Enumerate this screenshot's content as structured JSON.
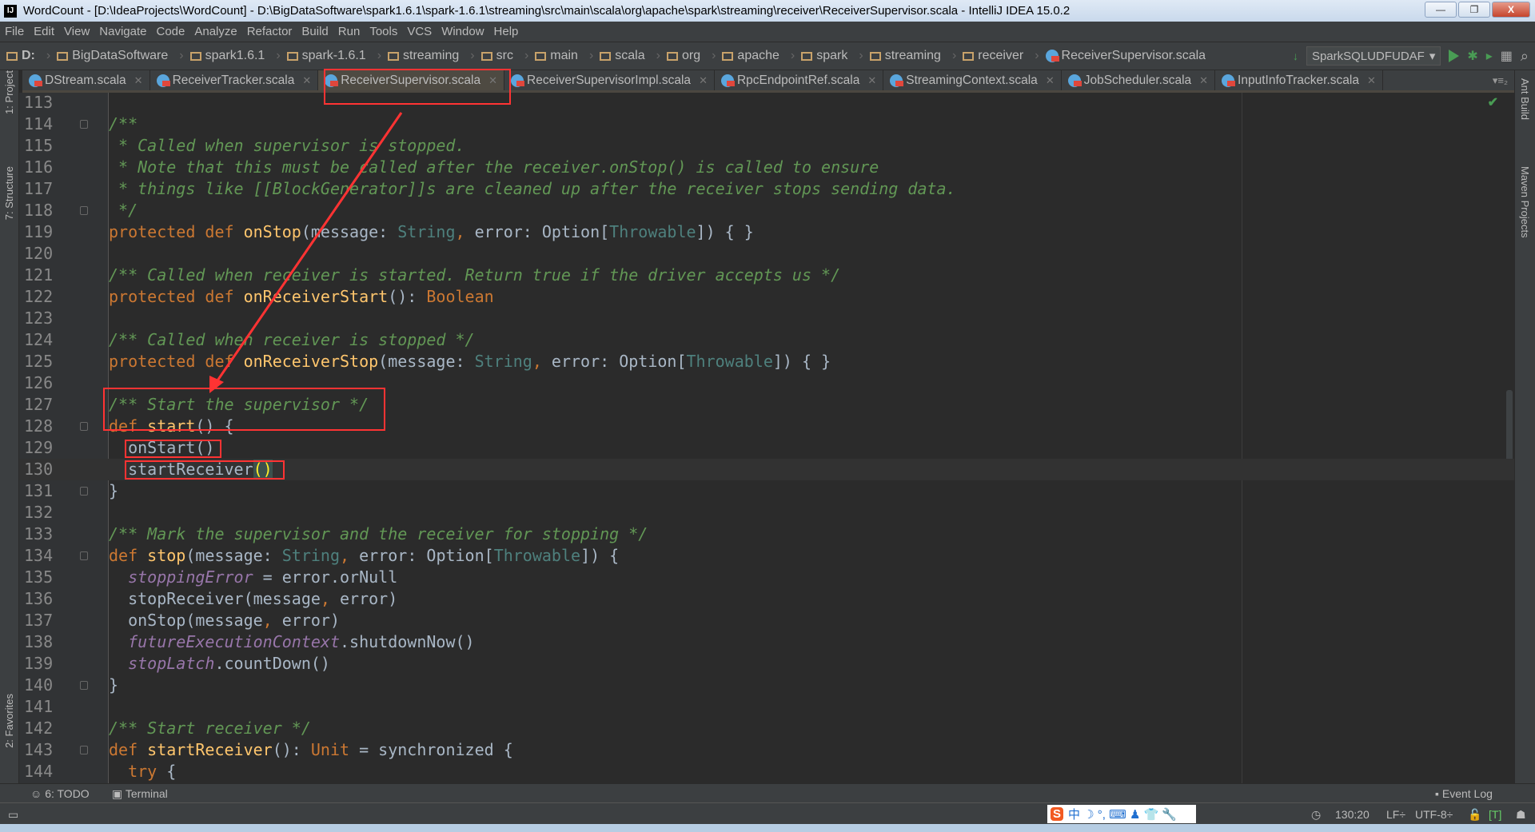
{
  "window": {
    "title": "WordCount - [D:\\IdeaProjects\\WordCount] - D:\\BigDataSoftware\\spark1.6.1\\spark-1.6.1\\streaming\\src\\main\\scala\\org\\apache\\spark\\streaming\\receiver\\ReceiverSupervisor.scala - IntelliJ IDEA 15.0.2",
    "logo": "IJ",
    "minimize": "—",
    "restore": "❐",
    "close": "X"
  },
  "menu": [
    "File",
    "Edit",
    "View",
    "Navigate",
    "Code",
    "Analyze",
    "Refactor",
    "Build",
    "Run",
    "Tools",
    "VCS",
    "Window",
    "Help"
  ],
  "breadcrumbs": [
    "D:",
    "BigDataSoftware",
    "spark1.6.1",
    "spark-1.6.1",
    "streaming",
    "src",
    "main",
    "scala",
    "org",
    "apache",
    "spark",
    "streaming",
    "receiver",
    "ReceiverSupervisor.scala"
  ],
  "run_config": "SparkSQLUDFUDAF",
  "tabs": [
    {
      "label": "DStream.scala"
    },
    {
      "label": "ReceiverTracker.scala"
    },
    {
      "label": "ReceiverSupervisor.scala",
      "active": true
    },
    {
      "label": "ReceiverSupervisorImpl.scala"
    },
    {
      "label": "RpcEndpointRef.scala"
    },
    {
      "label": "StreamingContext.scala"
    },
    {
      "label": "JobScheduler.scala"
    },
    {
      "label": "InputInfoTracker.scala"
    }
  ],
  "tab_menu": "▾≡₂",
  "left_tools": [
    "1: Project",
    "7: Structure",
    "2: Favorites"
  ],
  "right_tools": [
    "Ant Build",
    "Maven Projects"
  ],
  "current_line": 130,
  "code": [
    {
      "n": 113,
      "t": []
    },
    {
      "n": 114,
      "fold": true,
      "t": [
        [
          "/**",
          "c"
        ]
      ]
    },
    {
      "n": 115,
      "t": [
        [
          " * Called when supervisor is stopped.",
          "c"
        ]
      ]
    },
    {
      "n": 116,
      "t": [
        [
          " * Note that this must be called after the receiver.onStop() is called to ensure",
          "c"
        ]
      ]
    },
    {
      "n": 117,
      "t": [
        [
          " * things like [[BlockGenerator]]s are cleaned up after the receiver stops sending data.",
          "c"
        ]
      ]
    },
    {
      "n": 118,
      "fold": true,
      "t": [
        [
          " */",
          "c"
        ]
      ]
    },
    {
      "n": 119,
      "t": [
        [
          "protected def ",
          "k"
        ],
        [
          "onStop",
          "f"
        ],
        [
          "(message: ",
          "n"
        ],
        [
          "String",
          "t"
        ],
        [
          ", ",
          "o"
        ],
        [
          "error: Option[",
          "n"
        ],
        [
          "Throwable",
          "t"
        ],
        [
          "]) { }",
          "n"
        ]
      ]
    },
    {
      "n": 120,
      "t": []
    },
    {
      "n": 121,
      "t": [
        [
          "/** Called when receiver is started. Return true if the driver accepts us */",
          "c"
        ]
      ]
    },
    {
      "n": 122,
      "t": [
        [
          "protected def ",
          "k"
        ],
        [
          "onReceiverStart",
          "f"
        ],
        [
          "(): ",
          "n"
        ],
        [
          "Boolean",
          "k"
        ]
      ]
    },
    {
      "n": 123,
      "t": []
    },
    {
      "n": 124,
      "t": [
        [
          "/** Called when receiver is stopped */",
          "c"
        ]
      ]
    },
    {
      "n": 125,
      "t": [
        [
          "protected def ",
          "k"
        ],
        [
          "onReceiverStop",
          "f"
        ],
        [
          "(message: ",
          "n"
        ],
        [
          "String",
          "t"
        ],
        [
          ", ",
          "o"
        ],
        [
          "error: Option[",
          "n"
        ],
        [
          "Throwable",
          "t"
        ],
        [
          "]) { }",
          "n"
        ]
      ]
    },
    {
      "n": 126,
      "t": []
    },
    {
      "n": 127,
      "t": [
        [
          "/** Start the supervisor */",
          "c"
        ]
      ]
    },
    {
      "n": 128,
      "fold": true,
      "t": [
        [
          "def ",
          "k"
        ],
        [
          "start",
          "f"
        ],
        [
          "() {",
          "n"
        ]
      ]
    },
    {
      "n": 129,
      "t": [
        [
          "  onStart()",
          "n"
        ]
      ]
    },
    {
      "n": 130,
      "t": [
        [
          "  startReceiver",
          "n"
        ],
        [
          "()",
          "y"
        ]
      ]
    },
    {
      "n": 131,
      "fold": true,
      "t": [
        [
          "}",
          "n"
        ]
      ]
    },
    {
      "n": 132,
      "t": []
    },
    {
      "n": 133,
      "t": [
        [
          "/** Mark the supervisor and the receiver for stopping */",
          "c"
        ]
      ]
    },
    {
      "n": 134,
      "fold": true,
      "t": [
        [
          "def ",
          "k"
        ],
        [
          "stop",
          "f"
        ],
        [
          "(message: ",
          "n"
        ],
        [
          "String",
          "t"
        ],
        [
          ", ",
          "o"
        ],
        [
          "error: Option[",
          "n"
        ],
        [
          "Throwable",
          "t"
        ],
        [
          "]) {",
          "n"
        ]
      ]
    },
    {
      "n": 135,
      "t": [
        [
          "  ",
          "n"
        ],
        [
          "stoppingError",
          "p"
        ],
        [
          " = error.orNull",
          "n"
        ]
      ]
    },
    {
      "n": 136,
      "t": [
        [
          "  stopReceiver(message",
          "n"
        ],
        [
          ", ",
          "o"
        ],
        [
          "error)",
          "n"
        ]
      ]
    },
    {
      "n": 137,
      "t": [
        [
          "  onStop(message",
          "n"
        ],
        [
          ", ",
          "o"
        ],
        [
          "error)",
          "n"
        ]
      ]
    },
    {
      "n": 138,
      "t": [
        [
          "  ",
          "n"
        ],
        [
          "futureExecutionContext",
          "p"
        ],
        [
          ".shutdownNow()",
          "n"
        ]
      ]
    },
    {
      "n": 139,
      "t": [
        [
          "  ",
          "n"
        ],
        [
          "stopLatch",
          "p"
        ],
        [
          ".countDown()",
          "n"
        ]
      ]
    },
    {
      "n": 140,
      "fold": true,
      "t": [
        [
          "}",
          "n"
        ]
      ]
    },
    {
      "n": 141,
      "t": []
    },
    {
      "n": 142,
      "t": [
        [
          "/** Start receiver */",
          "c"
        ]
      ]
    },
    {
      "n": 143,
      "fold": true,
      "t": [
        [
          "def ",
          "k"
        ],
        [
          "startReceiver",
          "f"
        ],
        [
          "(): ",
          "n"
        ],
        [
          "Unit",
          "k"
        ],
        [
          " = synchronized {",
          "n"
        ]
      ]
    },
    {
      "n": 144,
      "t": [
        [
          "  try ",
          "k"
        ],
        [
          "{",
          "n"
        ]
      ]
    }
  ],
  "bottom_tools": {
    "todo": "6: TODO",
    "terminal": "Terminal",
    "event_log": "Event Log"
  },
  "status": {
    "position": "130:20",
    "line_sep": "LF÷",
    "encoding": "UTF-8÷"
  },
  "ime": {
    "logo": "S",
    "text": "中 ☽ °, ⌨ ♟ 👕 🔧"
  },
  "annotation_color": "#ff3333"
}
